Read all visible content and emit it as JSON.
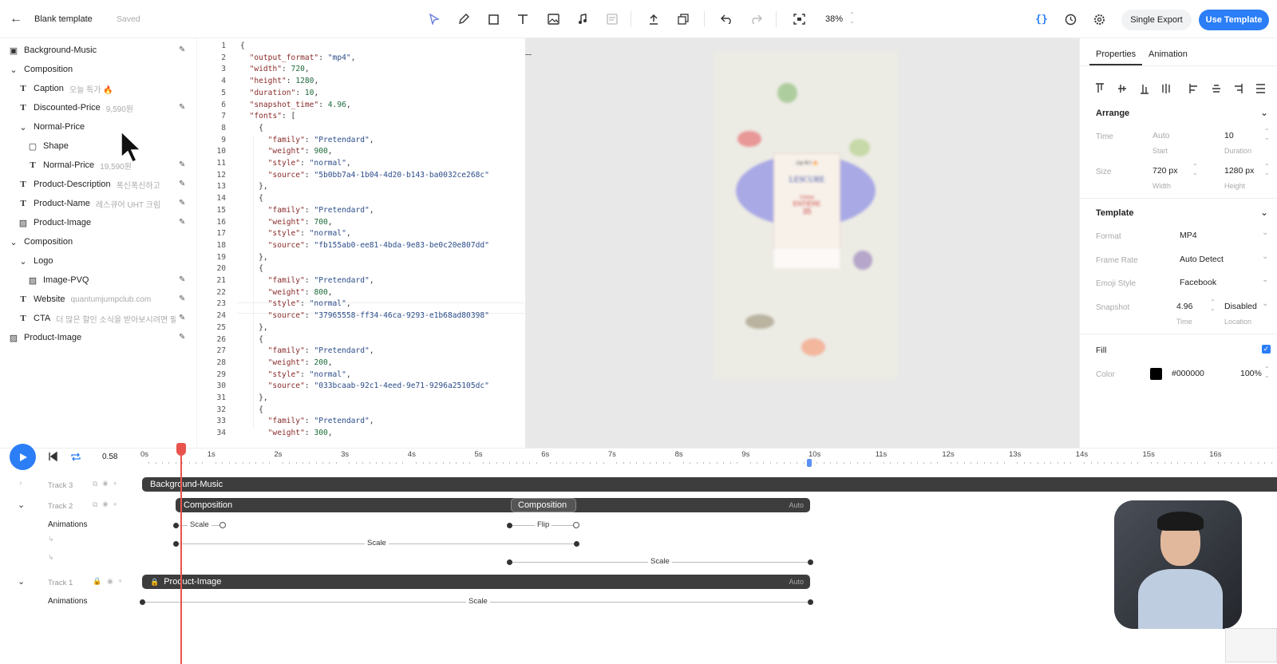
{
  "header": {
    "title": "Blank template",
    "saved": "Saved",
    "zoom": "38%",
    "single_export": "Single Export",
    "use_template": "Use Template",
    "accent": "#2b7ef6"
  },
  "layers": [
    {
      "label": "Background-Music",
      "sub": "",
      "icon": "audio-icon",
      "edit": true
    },
    {
      "label": "Composition",
      "sub": "",
      "icon": "chevron-down-icon",
      "edit": false
    },
    {
      "label": "Caption",
      "sub": "오늘 특가 🔥",
      "icon": "text-icon",
      "edit": false
    },
    {
      "label": "Discounted-Price",
      "sub": "9,590원",
      "icon": "text-icon",
      "edit": true
    },
    {
      "label": "Normal-Price",
      "sub": "",
      "icon": "chevron-down-icon",
      "edit": false
    },
    {
      "label": "Shape",
      "sub": "",
      "icon": "shape-icon",
      "edit": false
    },
    {
      "label": "Normal-Price",
      "sub": "19,590원",
      "icon": "text-icon",
      "edit": true
    },
    {
      "label": "Product-Description",
      "sub": "폭신폭신하고 담...",
      "icon": "text-icon",
      "edit": true
    },
    {
      "label": "Product-Name",
      "sub": "레스큐어 UHT 크림",
      "icon": "text-icon",
      "edit": true
    },
    {
      "label": "Product-Image",
      "sub": "",
      "icon": "image-icon",
      "edit": true
    },
    {
      "label": "Composition",
      "sub": "",
      "icon": "chevron-down-icon",
      "edit": false
    },
    {
      "label": "Logo",
      "sub": "",
      "icon": "chevron-down-icon",
      "edit": false
    },
    {
      "label": "Image-PVQ",
      "sub": "",
      "icon": "image-icon",
      "edit": true
    },
    {
      "label": "Website",
      "sub": "quantumjumpclub.com",
      "icon": "text-icon",
      "edit": true
    },
    {
      "label": "CTA",
      "sub": "더 많은 할인 소식을 받아보시려면 팔...",
      "icon": "text-icon",
      "edit": true
    },
    {
      "label": "Product-Image",
      "sub": "",
      "icon": "image-icon",
      "edit": true
    }
  ],
  "code_lines": [
    "{",
    "  \"output_format\": \"mp4\",",
    "  \"width\": 720,",
    "  \"height\": 1280,",
    "  \"duration\": 10,",
    "  \"snapshot_time\": 4.96,",
    "  \"fonts\": [",
    "    {",
    "      \"family\": \"Pretendard\",",
    "      \"weight\": 900,",
    "      \"style\": \"normal\",",
    "      \"source\": \"5b0bb7a4-1b04-4d20-b143-ba0032ce268c\"",
    "    },",
    "    {",
    "      \"family\": \"Pretendard\",",
    "      \"weight\": 700,",
    "      \"style\": \"normal\",",
    "      \"source\": \"fb155ab0-ee81-4bda-9e83-be0c20e807dd\"",
    "    },",
    "    {",
    "      \"family\": \"Pretendard\",",
    "      \"weight\": 800,",
    "      \"style\": \"normal\",",
    "      \"source\": \"37965558-ff34-46ca-9293-e1b68ad80398\"",
    "    },",
    "    {",
    "      \"family\": \"Pretendard\",",
    "      \"weight\": 200,",
    "      \"style\": \"normal\",",
    "      \"source\": \"033bcaab-92c1-4eed-9e71-9296a25105dc\"",
    "    },",
    "    {",
    "      \"family\": \"Pretendard\",",
    "      \"weight\": 300,"
  ],
  "properties": {
    "tab_properties": "Properties",
    "tab_animation": "Animation",
    "arrange": "Arrange",
    "time_label": "Time",
    "time_start": "Auto",
    "time_start_sub": "Start",
    "time_duration": "10",
    "time_duration_sub": "Duration",
    "size_label": "Size",
    "size_width": "720 px",
    "size_width_sub": "Width",
    "size_height": "1280 px",
    "size_height_sub": "Height",
    "template": "Template",
    "format_label": "Format",
    "format_value": "MP4",
    "frame_rate_label": "Frame Rate",
    "frame_rate_value": "Auto Detect",
    "emoji_label": "Emoji Style",
    "emoji_value": "Facebook",
    "snapshot_label": "Snapshot",
    "snapshot_time": "4.96",
    "snapshot_time_sub": "Time",
    "snapshot_location": "Disabled",
    "snapshot_location_sub": "Location",
    "fill": "Fill",
    "color_label": "Color",
    "color_hex": "#000000",
    "color_opacity": "100%"
  },
  "timeline": {
    "current_time": "0.58",
    "ticks": [
      "0s",
      "1s",
      "2s",
      "3s",
      "4s",
      "5s",
      "6s",
      "7s",
      "8s",
      "9s",
      "10s",
      "11s",
      "12s",
      "13s",
      "14s",
      "15s",
      "16s"
    ],
    "tracks": {
      "track3": "Track 3",
      "track2": "Track 2",
      "track1": "Track 1",
      "animations": "Animations",
      "bg_music": "Background-Music",
      "composition1": "Composition",
      "composition2": "Composition",
      "product_image": "Product-Image",
      "auto": "Auto",
      "scale": "Scale",
      "flip": "Flip"
    }
  },
  "preview": {
    "brand": "LESCURE",
    "sub1": "Crème",
    "sub2": "ENTIÈRE",
    "badge": "오늘 특가 🔥"
  }
}
